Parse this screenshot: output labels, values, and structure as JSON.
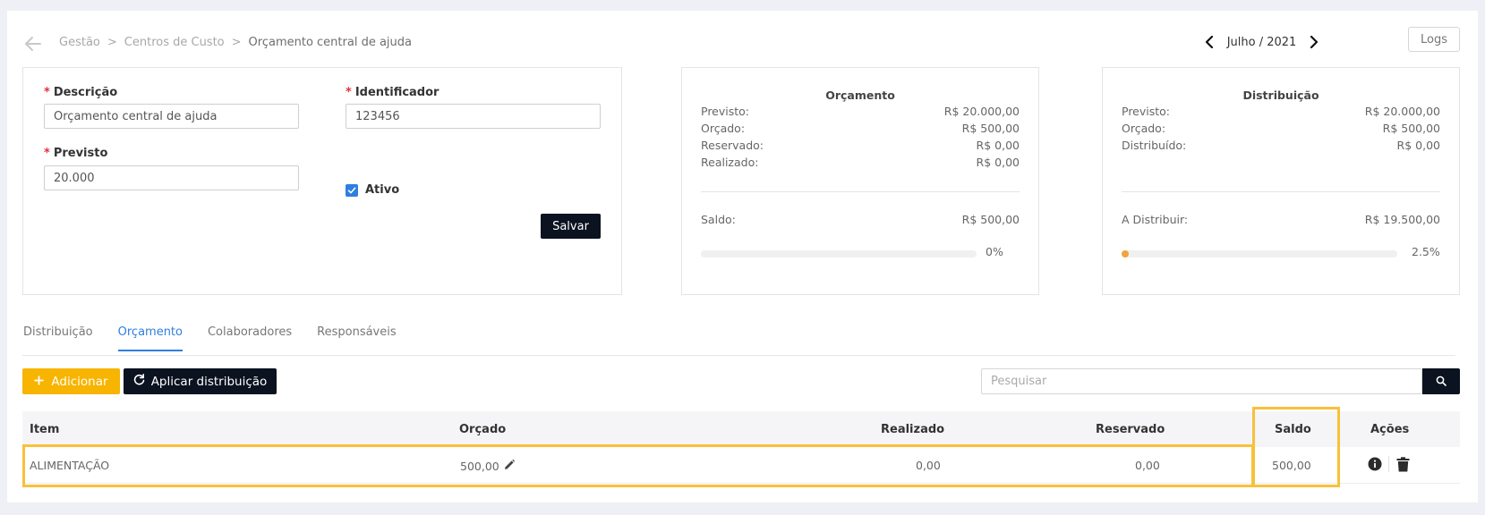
{
  "breadcrumb": {
    "items": [
      "Gestão",
      "Centros de Custo"
    ],
    "current": "Orçamento central de ajuda"
  },
  "period": {
    "label": "Julho / 2021"
  },
  "logs_label": "Logs",
  "form": {
    "descricao": {
      "label": "Descrição",
      "value": "Orçamento central de ajuda"
    },
    "identificador": {
      "label": "Identificador",
      "value": "123456"
    },
    "previsto": {
      "label": "Previsto",
      "value": "20.000"
    },
    "ativo": {
      "label": "Ativo",
      "checked": true
    },
    "save_label": "Salvar"
  },
  "orcamento_summary": {
    "title": "Orçamento",
    "rows": [
      {
        "label": "Previsto:",
        "value": "R$ 20.000,00"
      },
      {
        "label": "Orçado:",
        "value": "R$ 500,00"
      },
      {
        "label": "Reservado:",
        "value": "R$ 0,00"
      },
      {
        "label": "Realizado:",
        "value": "R$ 0,00"
      }
    ],
    "total_label": "Saldo:",
    "total_value": "R$ 500,00",
    "progress_pct": 0,
    "progress_label": "0%"
  },
  "distribuicao_summary": {
    "title": "Distribuição",
    "rows": [
      {
        "label": "Previsto:",
        "value": "R$ 20.000,00"
      },
      {
        "label": "Orçado:",
        "value": "R$ 500,00"
      },
      {
        "label": "Distribuído:",
        "value": "R$ 0,00"
      }
    ],
    "total_label": "A Distribuir:",
    "total_value": "R$ 19.500,00",
    "progress_pct": 2.5,
    "progress_label": "2.5%"
  },
  "tabs": [
    {
      "label": "Distribuição",
      "active": false
    },
    {
      "label": "Orçamento",
      "active": true
    },
    {
      "label": "Colaboradores",
      "active": false
    },
    {
      "label": "Responsáveis",
      "active": false
    }
  ],
  "toolbar": {
    "add_label": "Adicionar",
    "apply_label": "Aplicar distribuição",
    "search_placeholder": "Pesquisar"
  },
  "table": {
    "columns": [
      "Item",
      "Orçado",
      "Realizado",
      "Reservado",
      "Saldo",
      "Ações"
    ],
    "rows": [
      {
        "item": "ALIMENTAÇÃO",
        "orcado": "500,00",
        "realizado": "0,00",
        "reservado": "0,00",
        "saldo": "500,00"
      }
    ]
  },
  "colors": {
    "accent": "#2f7fe0",
    "warning": "#f7b400",
    "dark": "#0b1220",
    "highlight": "#f7c13a",
    "required": "#e0323a"
  },
  "icons": [
    "back-arrow-icon",
    "chevron-left-icon",
    "chevron-right-icon",
    "checkbox-check-icon",
    "plus-icon",
    "refresh-icon",
    "search-icon",
    "pencil-icon",
    "info-icon",
    "trash-icon"
  ]
}
